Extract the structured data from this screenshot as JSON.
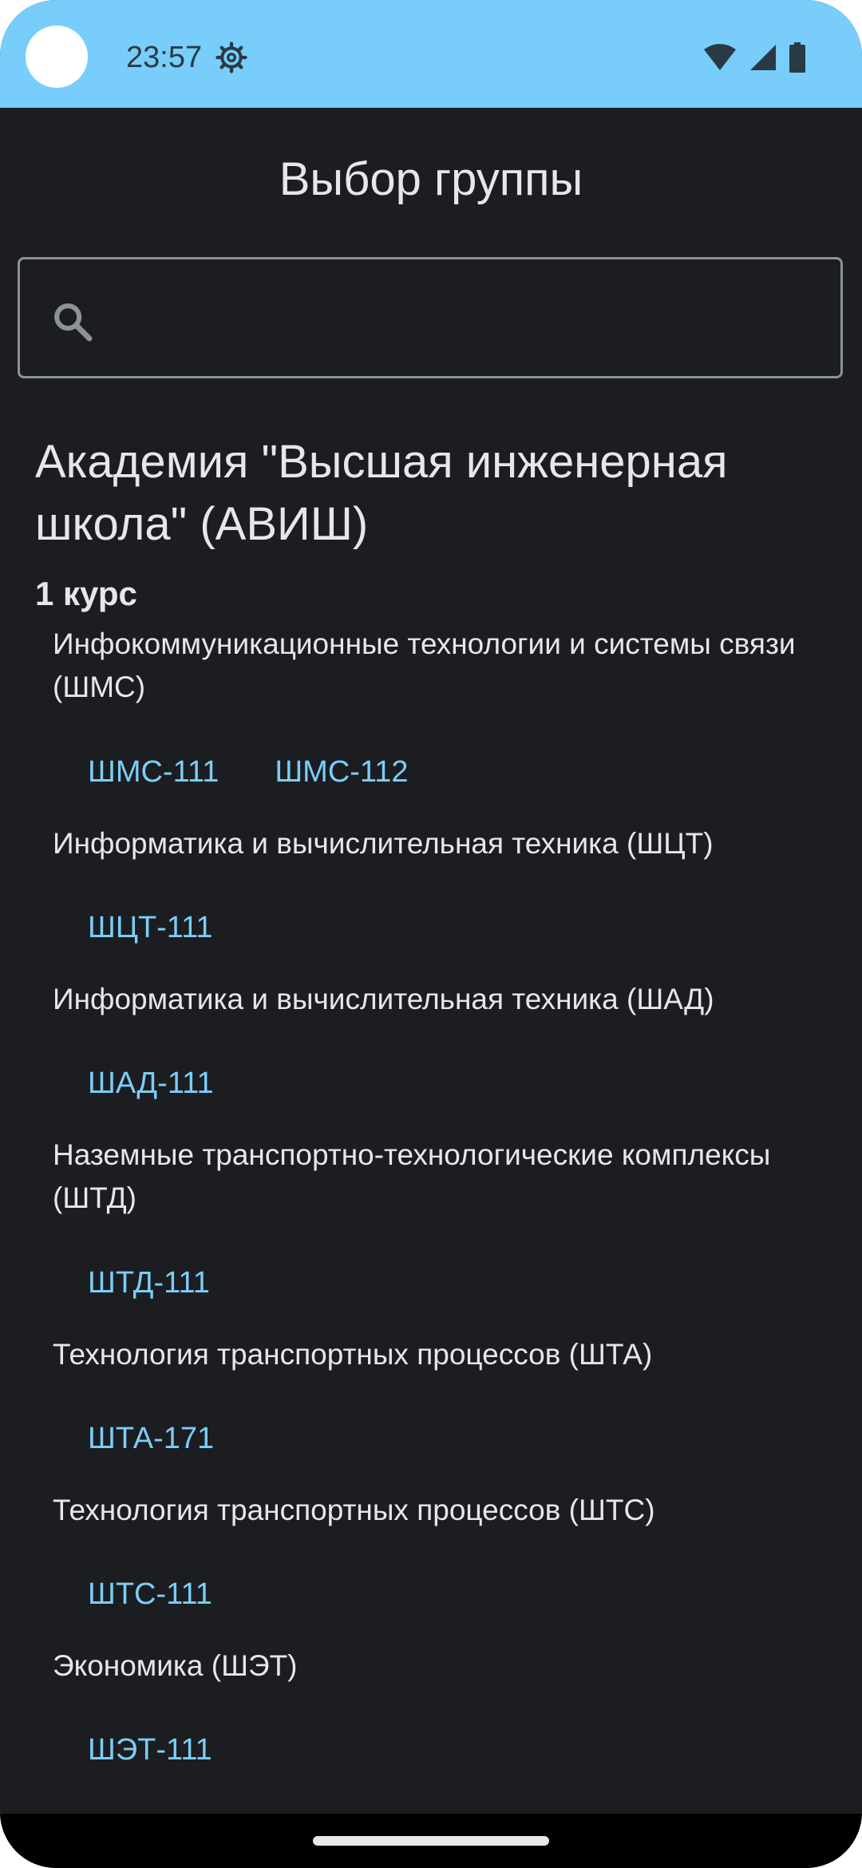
{
  "status_bar": {
    "time": "23:57",
    "icons": [
      "settings-gear-icon",
      "wifi-icon",
      "signal-icon",
      "battery-icon"
    ],
    "background": "#78cdfb"
  },
  "header": {
    "title": "Выбор группы"
  },
  "search": {
    "placeholder": "",
    "value": ""
  },
  "institute": {
    "title": "Академия \"Высшая инженерная школа\" (АВИШ)",
    "course": "1 курс",
    "specialties": [
      {
        "name": "Инфокоммуникационные технологии и системы связи (ШМС)",
        "groups": [
          "ШМС-111",
          "ШМС-112"
        ]
      },
      {
        "name": "Информатика и вычислительная техника (ШЦТ)",
        "groups": [
          "ШЦТ-111"
        ]
      },
      {
        "name": "Информатика и вычислительная техника (ШАД)",
        "groups": [
          "ШАД-111"
        ]
      },
      {
        "name": "Наземные транспортно-технологические комплексы (ШТД)",
        "groups": [
          "ШТД-111"
        ]
      },
      {
        "name": "Технология транспортных процессов (ШТА)",
        "groups": [
          "ШТА-171"
        ]
      },
      {
        "name": "Технология транспортных процессов (ШТС)",
        "groups": [
          "ШТС-111"
        ]
      },
      {
        "name": "Экономика (ШЭТ)",
        "groups": [
          "ШЭТ-111"
        ]
      }
    ]
  },
  "colors": {
    "background": "#1b1d20",
    "text": "#e6e7e8",
    "link": "#7ccdf8"
  }
}
